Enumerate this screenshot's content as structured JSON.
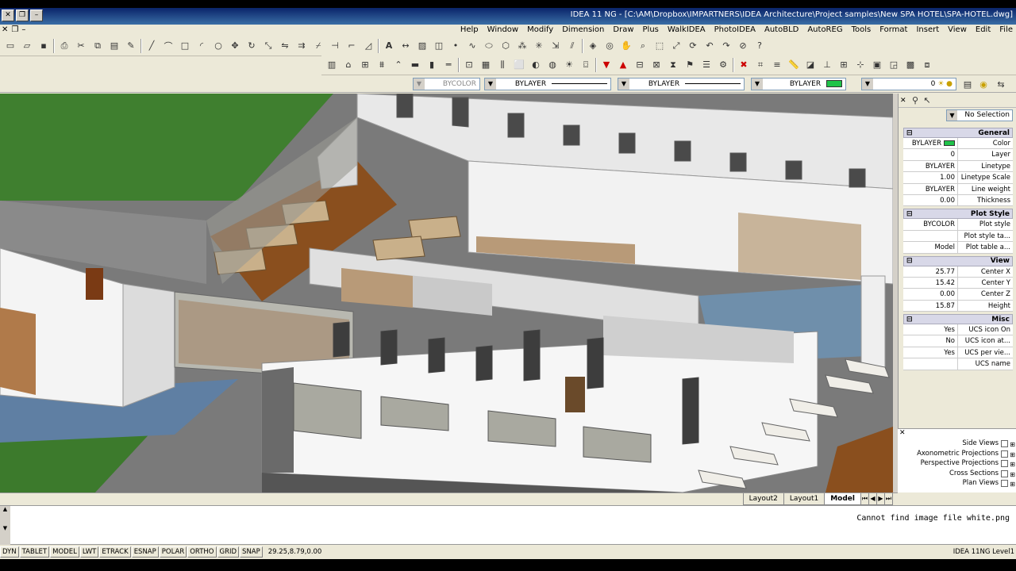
{
  "window": {
    "title": "IDEA 11 NG - [C:\\AM\\Dropbox\\IMPARTNERS\\IDEA Architecture\\Project samples\\New SPA HOTEL\\SPA-HOTEL.dwg]",
    "controls": [
      "–",
      "❐",
      "✕"
    ]
  },
  "menu": {
    "items": [
      "File",
      "Edit",
      "View",
      "Insert",
      "Format",
      "Tools",
      "AutoREG",
      "AutoBLD",
      "PhotoIDEA",
      "WalkIDEA",
      "Plus",
      "Draw",
      "Dimension",
      "Modify",
      "Window",
      "Help"
    ],
    "mdi_controls": [
      "✕",
      "❐",
      "–"
    ]
  },
  "properties_bar": {
    "plotstyle": "BYCOLOR",
    "lineweight": "BYLAYER",
    "linetype": "BYLAYER",
    "color": "BYLAYER",
    "layer": "0"
  },
  "side_panel": {
    "selection": "No Selection",
    "categories": [
      {
        "name": "General",
        "rows": [
          {
            "key": "Color",
            "value": "BYLAYER",
            "swatch": true
          },
          {
            "key": "Layer",
            "value": "0"
          },
          {
            "key": "Linetype",
            "value": "BYLAYER"
          },
          {
            "key": "Linetype Scale",
            "value": "1.00"
          },
          {
            "key": "Line weight",
            "value": "BYLAYER"
          },
          {
            "key": "Thickness",
            "value": "0.00"
          }
        ]
      },
      {
        "name": "Plot Style",
        "rows": [
          {
            "key": "Plot style",
            "value": "BYCOLOR"
          },
          {
            "key": "Plot style ta...",
            "value": ""
          },
          {
            "key": "Plot table a...",
            "value": "Model"
          }
        ]
      },
      {
        "name": "View",
        "rows": [
          {
            "key": "Center X",
            "value": "25.77"
          },
          {
            "key": "Center Y",
            "value": "15.42"
          },
          {
            "key": "Center Z",
            "value": "0.00"
          },
          {
            "key": "Height",
            "value": "15.87"
          }
        ]
      },
      {
        "name": "Misc",
        "rows": [
          {
            "key": "UCS icon On",
            "value": "Yes"
          },
          {
            "key": "UCS icon at...",
            "value": "No"
          },
          {
            "key": "UCS per vie...",
            "value": "Yes"
          },
          {
            "key": "UCS name",
            "value": ""
          }
        ]
      }
    ]
  },
  "tree": {
    "items": [
      "Side Views",
      "Axonometric Projections",
      "Perspective Projections",
      "Cross Sections",
      "Plan Views"
    ]
  },
  "tabs": {
    "items": [
      "Model",
      "Layout1",
      "Layout2"
    ],
    "active": "Model"
  },
  "command_line": {
    "message": "Cannot find image file white.png"
  },
  "status_bar": {
    "coordinates": "29.25,8.79,0.00",
    "toggles": [
      "SNAP",
      "GRID",
      "ORTHO",
      "POLAR",
      "ESNAP",
      "ETRACK",
      "LWT",
      "MODEL",
      "TABLET",
      "DYN"
    ],
    "version": "IDEA 11NG Level1"
  },
  "colors": {
    "title_bar": "#0a246a",
    "accent_green": "#1fc34a",
    "chrome": "#ece9d8"
  }
}
